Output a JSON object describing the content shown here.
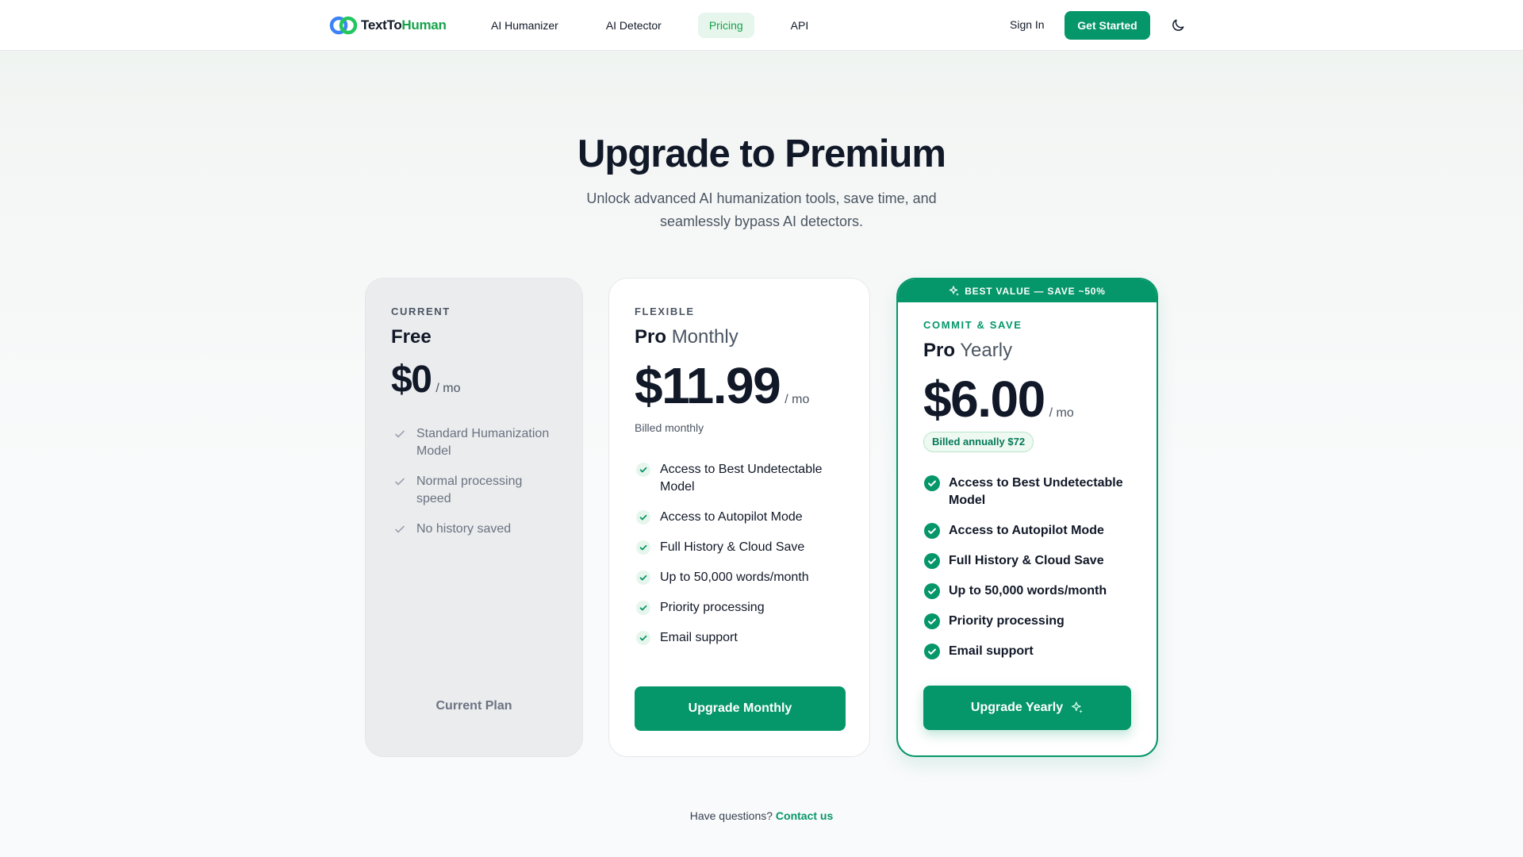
{
  "nav": {
    "logo_part1": "TextTo",
    "logo_part2": "Human",
    "links": [
      {
        "label": "AI Humanizer"
      },
      {
        "label": "AI Detector"
      },
      {
        "label": "Pricing"
      },
      {
        "label": "API"
      }
    ],
    "active_link": "Pricing",
    "sign_in": "Sign In",
    "get_started": "Get Started",
    "theme_icon": "moon-icon"
  },
  "hero": {
    "title": "Upgrade to Premium",
    "subtitle": "Unlock advanced AI humanization tools, save time, and seamlessly bypass AI detectors."
  },
  "plans": {
    "free": {
      "eyebrow": "CURRENT",
      "name": "Free",
      "price": "$0",
      "per": "/ mo",
      "features": [
        "Standard Humanization Model",
        "Normal processing speed",
        "No history saved"
      ],
      "action": "Current Plan"
    },
    "monthly": {
      "eyebrow": "FLEXIBLE",
      "name_bold": "Pro",
      "name_light": "Monthly",
      "price": "$11.99",
      "per": "/ mo",
      "billing": "Billed monthly",
      "features": [
        "Access to Best Undetectable Model",
        "Access to Autopilot Mode",
        "Full History & Cloud Save",
        "Up to 50,000 words/month",
        "Priority processing",
        "Email support"
      ],
      "cta": "Upgrade Monthly"
    },
    "yearly": {
      "banner": "BEST VALUE — SAVE ~50%",
      "eyebrow": "COMMIT & SAVE",
      "name_bold": "Pro",
      "name_light": "Yearly",
      "price": "$6.00",
      "per": "/ mo",
      "billing": "Billed annually $72",
      "features": [
        "Access to Best Undetectable Model",
        "Access to Autopilot Mode",
        "Full History & Cloud Save",
        "Up to 50,000 words/month",
        "Priority processing",
        "Email support"
      ],
      "cta": "Upgrade Yearly"
    }
  },
  "footer": {
    "question": "Have questions?",
    "contact": "Contact us"
  },
  "colors": {
    "brand_green": "#059669",
    "active_tab_bg": "#e7f6ec",
    "text_dark": "#111827",
    "muted": "#6b7280"
  }
}
